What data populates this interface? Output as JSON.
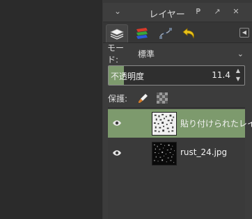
{
  "dock": {
    "title": "レイヤー",
    "collapse_icon": "chevron-down-icon",
    "buttons": [
      "pin-icon",
      "detach-icon",
      "close-icon"
    ]
  },
  "tabs": [
    {
      "name": "layers-tab",
      "icon": "layers-stack-icon",
      "active": true
    },
    {
      "name": "channels-tab",
      "icon": "color-channels-icon",
      "active": false
    },
    {
      "name": "paths-tab",
      "icon": "paths-icon",
      "active": false
    },
    {
      "name": "undo-history-tab",
      "icon": "undo-icon",
      "active": false
    }
  ],
  "mode": {
    "label": "モード:",
    "value": "標準"
  },
  "opacity": {
    "label": "不透明度",
    "value": "11.4",
    "fraction": 0.114
  },
  "lock": {
    "label": "保護:",
    "icons": [
      "paintbrush-lock-icon",
      "alpha-lock-icon"
    ]
  },
  "layers": [
    {
      "name": "貼り付けられたレイ",
      "selected": true,
      "visible": true
    },
    {
      "name": "rust_24.jpg",
      "selected": false,
      "visible": true
    }
  ],
  "colors": {
    "selection": "#7d9a6d",
    "panel": "#3c3c3c",
    "canvas": "#2b2b2b"
  }
}
